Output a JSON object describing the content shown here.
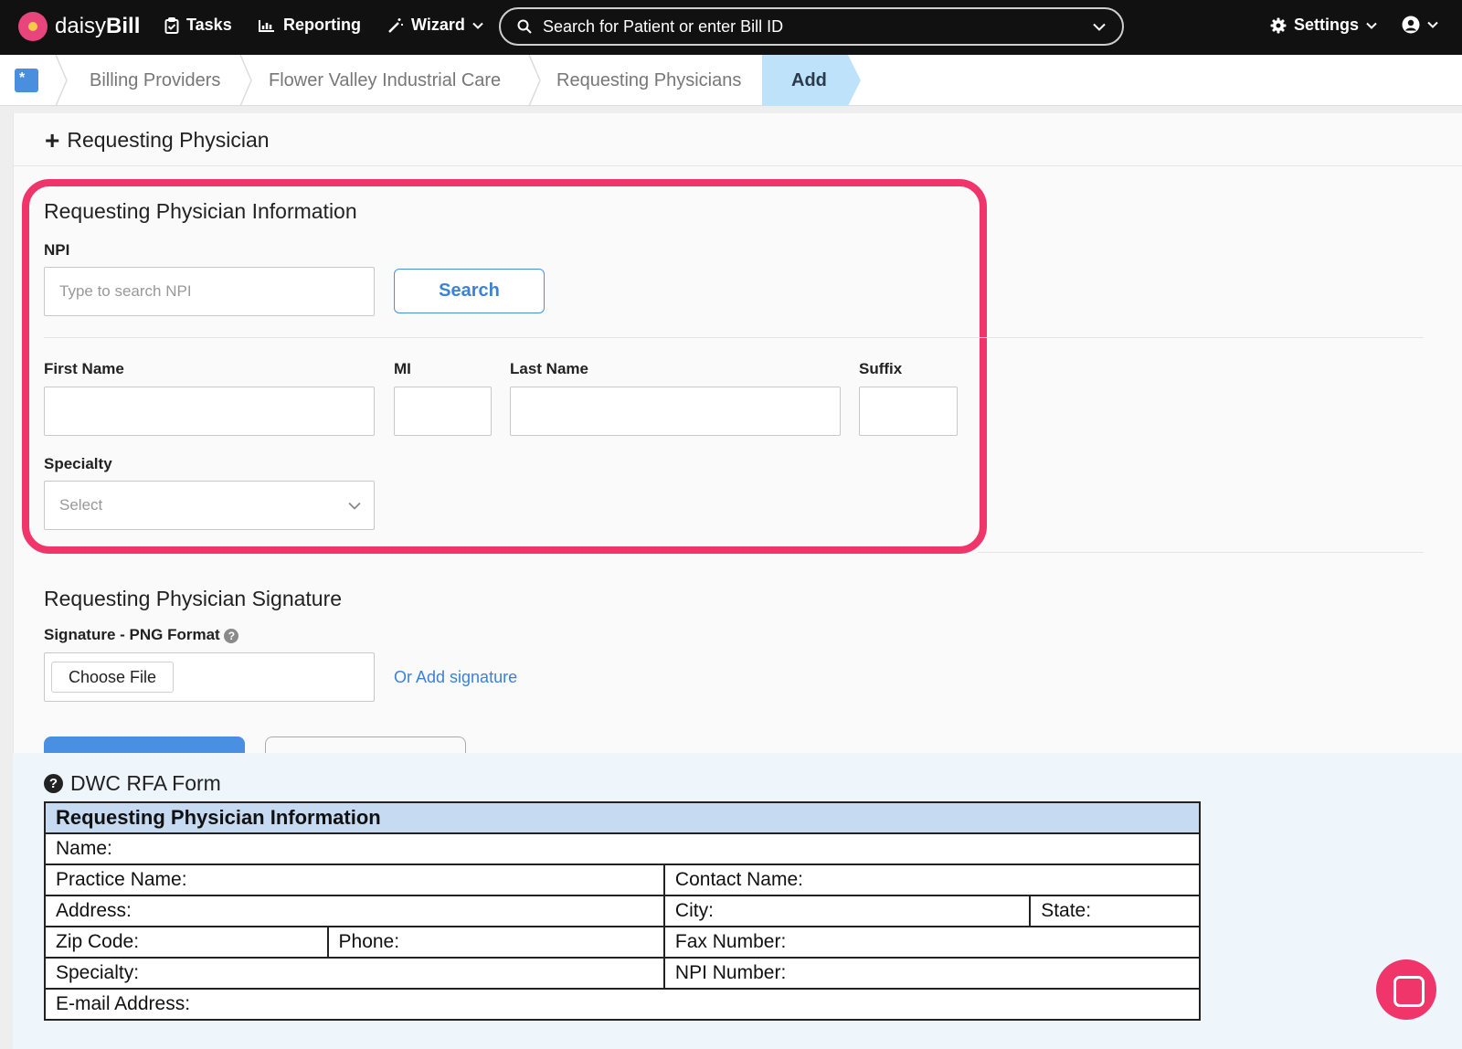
{
  "nav": {
    "brand_prefix": "daisy",
    "brand_suffix": "Bill",
    "tasks": "Tasks",
    "reporting": "Reporting",
    "wizard": "Wizard",
    "search_placeholder": "Search for Patient or enter Bill ID",
    "settings": "Settings"
  },
  "breadcrumb": [
    "Billing Providers",
    "Flower Valley Industrial Care",
    "Requesting Physicians",
    "Add"
  ],
  "page": {
    "title": "Requesting Physician",
    "info_section": "Requesting Physician Information",
    "npi_label": "NPI",
    "npi_placeholder": "Type to search NPI",
    "search_button": "Search",
    "first_name_label": "First Name",
    "mi_label": "MI",
    "last_name_label": "Last Name",
    "suffix_label": "Suffix",
    "specialty_label": "Specialty",
    "specialty_value": "Select",
    "signature_section": "Requesting Physician Signature",
    "signature_label": "Signature - PNG Format",
    "choose_file": "Choose File",
    "add_signature_link": "Or Add signature"
  },
  "dwc": {
    "title": "DWC RFA Form",
    "table_header": "Requesting Physician Information",
    "name": "Name:",
    "practice_name": "Practice Name:",
    "contact_name": "Contact Name:",
    "address": "Address:",
    "city": "City:",
    "state": "State:",
    "zip": "Zip Code:",
    "phone": "Phone:",
    "fax": "Fax Number:",
    "specialty": "Specialty:",
    "npi_number": "NPI Number:",
    "email": "E-mail Address:"
  },
  "colors": {
    "accent": "#4a90e2",
    "highlight": "#f0356b",
    "nav_bg": "#111111",
    "breadcrumb_active": "#bfe2fb"
  }
}
